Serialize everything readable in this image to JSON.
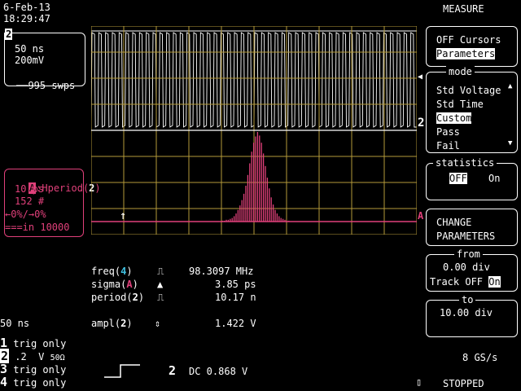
{
  "header": {
    "date": "6-Feb-13",
    "time": "18:29:47"
  },
  "trace_box": {
    "channel": "2",
    "timebase": "50 ns",
    "volts": "200mV",
    "sweeps": "995 swps"
  },
  "hist_box": {
    "source": "A",
    "label": ":Hperiod(",
    "channel": "2",
    "close": ")",
    "bin": "10 ps",
    "count": "152 #",
    "range": "←0%/→0%",
    "avg": "===in 10000"
  },
  "traces": {
    "upper_marker": "2",
    "lower_marker": "A"
  },
  "measurements": [
    {
      "name": "freq(",
      "ch": "4",
      "close": ")",
      "icon": "square-wave-icon",
      "value": "98.3097 MHz"
    },
    {
      "name": "sigma(",
      "ch": "A",
      "close": ")",
      "icon": "histogram-peak-icon",
      "value": "3.85 ps"
    },
    {
      "name": "period(",
      "ch": "2",
      "close": ")",
      "icon": "square-wave-icon",
      "value": "10.17 n"
    },
    {
      "name": "ampl(",
      "ch": "2",
      "close": ")",
      "icon": "vertical-arrows-icon",
      "value": "1.422 V"
    }
  ],
  "bottom_left": {
    "timebase": "50 ns",
    "channels": [
      {
        "num": "1",
        "text": "trig only",
        "extra": ""
      },
      {
        "num": "2",
        "text": " .2  V ",
        "extra": "50Ω"
      },
      {
        "num": "3",
        "text": "trig only",
        "extra": ""
      },
      {
        "num": "4",
        "text": "trig only",
        "extra": ""
      }
    ]
  },
  "trigger": {
    "channel": "2",
    "text": "DC 0.868 V"
  },
  "sidebar": {
    "title": "MEASURE",
    "view": {
      "off_label": "OFF Cursors",
      "params_label": "Parameters"
    },
    "mode": {
      "legend": "mode",
      "items": [
        "Std Voltage",
        "Std Time",
        "Custom",
        "Pass",
        "Fail"
      ],
      "selected": "Custom"
    },
    "statistics": {
      "legend": "statistics",
      "off": "OFF",
      "on": "On"
    },
    "change": {
      "line1": "CHANGE",
      "line2": "PARAMETERS"
    },
    "from": {
      "legend": "from",
      "value": "0.00 div",
      "track": "Track OFF",
      "on": "On"
    },
    "to": {
      "legend": "to",
      "value": "10.00 div"
    }
  },
  "status": {
    "rate": "8 GS/s",
    "state": "STOPPED"
  },
  "colors": {
    "grid": "#b59a3a",
    "trace_upper": "#ffffff",
    "trace_lower": "#e0407a",
    "accent": "#e0407a",
    "cyan": "#40c0e0"
  },
  "chart_data": {
    "type": "bar",
    "title": "",
    "xlabel": "",
    "ylabel": "",
    "note": "histogram of period values, peak near center",
    "values": [
      1,
      1,
      2,
      2,
      3,
      4,
      6,
      9,
      13,
      18,
      24,
      31,
      40,
      52,
      65,
      78,
      88,
      95,
      100,
      96,
      88,
      76,
      62,
      49,
      37,
      27,
      19,
      13,
      9,
      6,
      4,
      3,
      2,
      1,
      1
    ]
  }
}
